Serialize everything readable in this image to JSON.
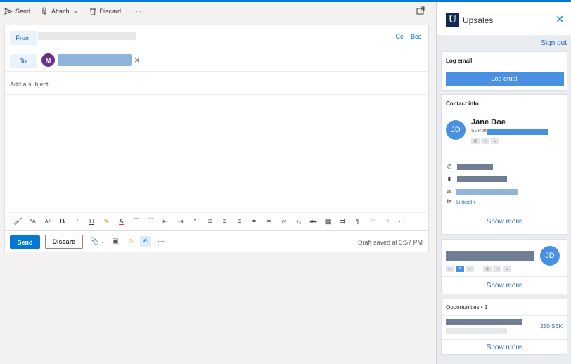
{
  "compose": {
    "toolbar": {
      "send_label": "Send",
      "attach_label": "Attach",
      "discard_label": "Discard",
      "more_label": "···"
    },
    "from_label": "From",
    "cc_label": "Cc",
    "bcc_label": "Bcc",
    "to_label": "To",
    "to_avatar_initial": "M",
    "subject_placeholder": "Add a subject",
    "format_icons": [
      "format-painter-icon",
      "font-size-icon",
      "grow-font-icon",
      "bold-icon",
      "italic-icon",
      "underline-icon",
      "highlight-icon",
      "font-color-icon",
      "bullets-icon",
      "numbering-icon",
      "decrease-indent-icon",
      "increase-indent-icon",
      "quote-icon",
      "align-left-icon",
      "align-center-icon",
      "align-right-icon",
      "link-icon",
      "unlink-icon",
      "superscript-icon",
      "subscript-icon",
      "strikethrough-icon",
      "table-icon",
      "ltr-icon",
      "rtl-icon",
      "undo-icon",
      "redo-icon",
      "more-icon"
    ],
    "send_button": "Send",
    "discard_button": "Discard",
    "draft_status": "Draft saved at 3:57 PM"
  },
  "panel": {
    "logo_letter": "U",
    "app_name": "Upsales",
    "close_label": "✕",
    "sign_out": "Sign out",
    "log_email": {
      "title": "Log email",
      "button": "Log email"
    },
    "contact": {
      "title": "Contact info",
      "initials": "JD",
      "name": "Jane Doe",
      "title_prefix": "SVP at",
      "linkedin": "LinkedIn",
      "show_more": "Show more"
    },
    "company": {
      "initials": "JD",
      "show_more": "Show more"
    },
    "opportunities": {
      "title": "Opportunities • 1",
      "value": "250 SEK",
      "show_more": "Show more"
    }
  },
  "colors": {
    "accent": "#0078d4",
    "upsales_blue": "#4a90e2",
    "upsales_navy": "#0f2a56",
    "to_avatar": "#6b2f8c"
  }
}
